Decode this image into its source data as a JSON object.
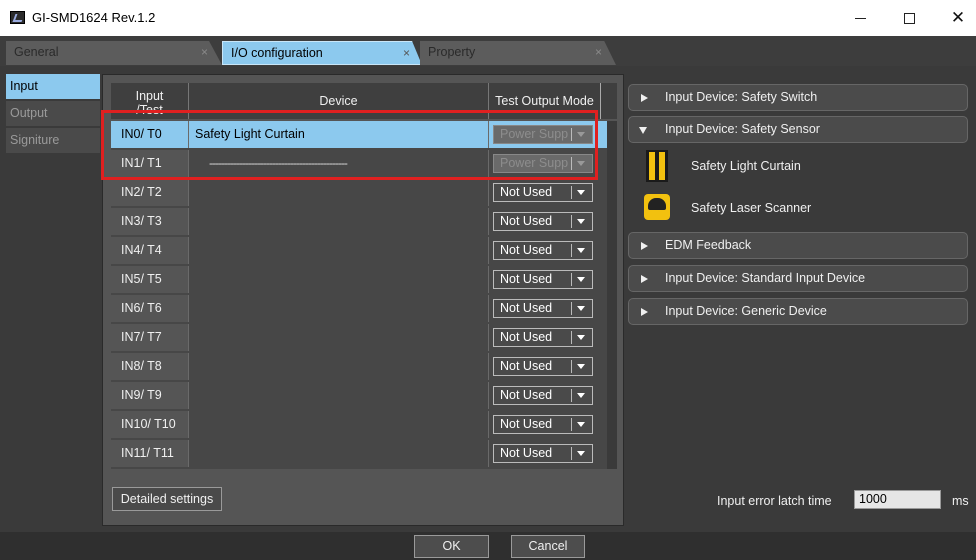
{
  "window": {
    "title": "GI-SMD1624 Rev.1.2"
  },
  "tabs": [
    {
      "label": "General",
      "active": false
    },
    {
      "label": "I/O configuration",
      "active": true
    },
    {
      "label": "Property",
      "active": false
    }
  ],
  "sidenav": [
    "Input",
    "Output",
    "Signiture"
  ],
  "grid": {
    "headers": {
      "input": "Input\n/Test",
      "device": "Device",
      "test_output_mode": "Test Output Mode"
    },
    "rows": [
      {
        "input": "IN0/ T0",
        "device": "Safety Light Curtain",
        "mode": "Power Supp",
        "mode_disabled": true,
        "selected": true
      },
      {
        "input": "IN1/ T1",
        "device": "----------------------------------------------",
        "mode": "Power Supp",
        "mode_disabled": true
      },
      {
        "input": "IN2/ T2",
        "device": "",
        "mode": "Not Used"
      },
      {
        "input": "IN3/ T3",
        "device": "",
        "mode": "Not Used"
      },
      {
        "input": "IN4/ T4",
        "device": "",
        "mode": "Not Used"
      },
      {
        "input": "IN5/ T5",
        "device": "",
        "mode": "Not Used"
      },
      {
        "input": "IN6/ T6",
        "device": "",
        "mode": "Not Used"
      },
      {
        "input": "IN7/ T7",
        "device": "",
        "mode": "Not Used"
      },
      {
        "input": "IN8/ T8",
        "device": "",
        "mode": "Not Used"
      },
      {
        "input": "IN9/ T9",
        "device": "",
        "mode": "Not Used"
      },
      {
        "input": "IN10/ T10",
        "device": "",
        "mode": "Not Used"
      },
      {
        "input": "IN11/ T11",
        "device": "",
        "mode": "Not Used"
      }
    ]
  },
  "buttons": {
    "detailed_settings": "Detailed settings",
    "ok": "OK",
    "cancel": "Cancel"
  },
  "device_panel": {
    "groups": [
      {
        "label": "Input Device: Safety Switch",
        "expanded": false
      },
      {
        "label": "Input Device: Safety Sensor",
        "expanded": true,
        "items": [
          {
            "label": "Safety Light Curtain",
            "icon": "light-curtain-icon"
          },
          {
            "label": "Safety Laser Scanner",
            "icon": "laser-scanner-icon"
          }
        ]
      },
      {
        "label": "EDM Feedback",
        "expanded": false
      },
      {
        "label": "Input Device: Standard Input Device",
        "expanded": false
      },
      {
        "label": "Input Device: Generic Device",
        "expanded": false
      }
    ]
  },
  "latch": {
    "label": "Input error latch time",
    "value": "1000",
    "unit": "ms"
  },
  "colors": {
    "accent": "#8cc9ee",
    "panel": "#3a3a3a",
    "highlight": "#e02020"
  }
}
